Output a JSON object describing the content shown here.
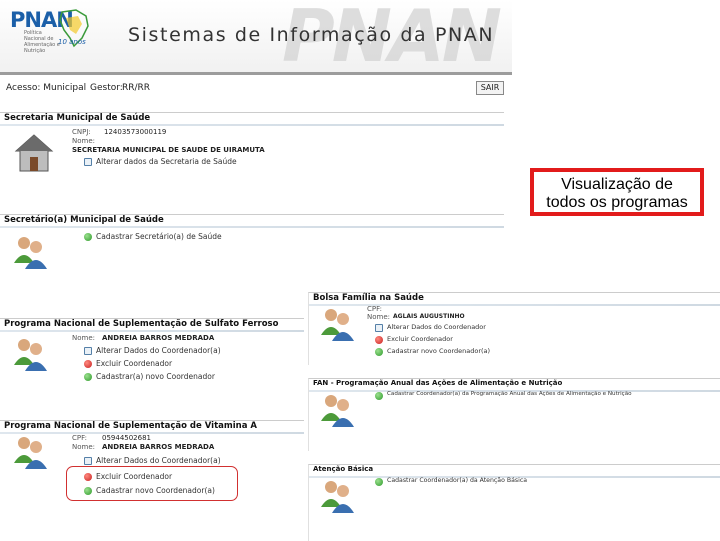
{
  "header": {
    "logo_text": "PNAN",
    "logo_sub": "Política Nacional de Alimentação e Nutrição",
    "logo_years": "10 anos",
    "system_title": "Sistemas de Informação da PNAN",
    "watermark": "PNAN"
  },
  "userbar": {
    "access_label": "Acesso: Municipal",
    "manager_label": "Gestor:",
    "manager_value": "RR/RR",
    "exit_label": "SAIR"
  },
  "secretaria": {
    "title": "Secretaria Municipal de Saúde",
    "cnpj_label": "CNPJ:",
    "cnpj_value": "12403573000119",
    "name_label": "Nome:",
    "name_value": "SECRETARIA MUNICIPAL DE SAUDE DE UIRAMUTA",
    "edit_action": "Alterar dados da Secretaria de Saúde"
  },
  "secretario": {
    "title": "Secretário(a) Municipal de Saúde",
    "register_action": "Cadastrar Secretário(a) de Saúde"
  },
  "ferro": {
    "title": "Programa Nacional de Suplementação de Sulfato Ferroso",
    "name_label": "Nome:",
    "name_value": "ANDREIA BARROS MEDRADA",
    "edit_action": "Alterar Dados do Coordenador(a)",
    "delete_action": "Excluir Coordenador",
    "register_action": "Cadastrar(a) novo Coordenador"
  },
  "vitamina": {
    "title": "Programa Nacional de Suplementação de Vitamina A",
    "cpf_label": "CPF:",
    "cpf_value": "05944502681",
    "name_label": "Nome:",
    "name_value": "ANDREIA BARROS MEDRADA",
    "edit_action": "Alterar Dados do Coordenador(a)",
    "delete_action": "Excluir Coordenador",
    "register_action": "Cadastrar novo Coordenador(a)"
  },
  "bolsa": {
    "title": "Bolsa Família na Saúde",
    "cpf_label": "CPF:",
    "name_label": "Nome:",
    "name_value": "AGLAIS AUGUSTINHO",
    "edit_action": "Alterar Dados do Coordenador",
    "delete_action": "Excluir Coordenador",
    "register_action": "Cadastrar novo Coordenador(a)"
  },
  "fan": {
    "title": "FAN - Programação Anual das Ações de Alimentação e Nutrição",
    "register_action": "Cadastrar Coordenador(a) da Programação Anual das Ações de Alimentação e Nutrição"
  },
  "atencao": {
    "title": "Atenção Básica",
    "register_action": "Cadastrar Coordenador(a) da Atenção Básica"
  },
  "callout": {
    "line1": "Visualização de",
    "line2": "todos os programas"
  },
  "colors": {
    "callout_border": "#e21b1b",
    "logo_blue": "#1b5fa8",
    "action_green": "#2e9a2a",
    "action_red": "#c82020"
  }
}
